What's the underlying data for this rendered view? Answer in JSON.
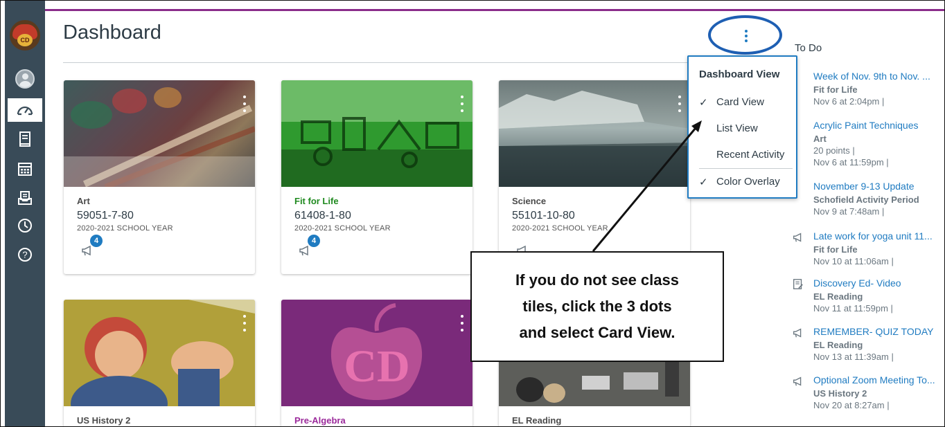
{
  "header": {
    "title": "Dashboard"
  },
  "cards": [
    {
      "name": "Art",
      "code": "59051-7-80",
      "term": "2020-2021 SCHOOL YEAR",
      "color": "#4a4a4a",
      "badge": "4"
    },
    {
      "name": "Fit for Life",
      "code": "61408-1-80",
      "term": "2020-2021 SCHOOL YEAR",
      "color": "#1f8a1f",
      "badge": "4"
    },
    {
      "name": "Science",
      "code": "55101-10-80",
      "term": "2020-2021 SCHOOL YEAR",
      "color": "#4a4a4a"
    },
    {
      "name": "US History 2",
      "color": "#4a4a4a"
    },
    {
      "name": "Pre-Algebra",
      "color": "#9b2a9b"
    },
    {
      "name": "EL Reading",
      "color": "#4a4a4a"
    }
  ],
  "menu": {
    "heading": "Dashboard View",
    "items": [
      {
        "label": "Card View",
        "checked": true
      },
      {
        "label": "List View",
        "checked": false
      },
      {
        "label": "Recent Activity",
        "checked": false
      },
      {
        "label": "Color Overlay",
        "checked": true
      }
    ],
    "check_glyph": "✓"
  },
  "todo": {
    "title": "To Do",
    "items": [
      {
        "title": "Week of Nov. 9th to Nov. ...",
        "course": "Fit for Life",
        "meta": [
          "Nov 6 at 2:04pm |"
        ],
        "icon": ""
      },
      {
        "title": "Acrylic Paint Techniques",
        "course": "Art",
        "meta": [
          "20 points |",
          "Nov 6 at 11:59pm |"
        ],
        "icon": ""
      },
      {
        "title": "November 9-13 Update",
        "course": "Schofield Activity Period",
        "meta": [
          "Nov 9 at 7:48am |"
        ],
        "icon": ""
      },
      {
        "title": "Late work for yoga unit 11...",
        "course": "Fit for Life",
        "meta": [
          "Nov 10 at 11:06am |"
        ],
        "icon": "announcement-icon"
      },
      {
        "title": "Discovery Ed- Video",
        "course": "EL Reading",
        "meta": [
          "Nov 11 at 11:59pm |"
        ],
        "icon": "assignment-icon"
      },
      {
        "title": "REMEMBER- QUIZ TODAY",
        "course": "EL Reading",
        "meta": [
          "Nov 13 at 11:39am |"
        ],
        "icon": "announcement-icon"
      },
      {
        "title": "Optional Zoom Meeting To...",
        "course": "US History 2",
        "meta": [
          "Nov 20 at 8:27am |"
        ],
        "icon": "announcement-icon"
      }
    ]
  },
  "annotation": {
    "lines": [
      "If you do not see class",
      "tiles, click the 3 dots",
      "and select Card View."
    ]
  },
  "logo": {
    "text": "CD"
  },
  "colors": {
    "nav_bg": "#394b58",
    "accent_blue": "#1f7bc1",
    "highlight_circle": "#1e5fb3",
    "top_stripe": "#8a2c8a"
  }
}
